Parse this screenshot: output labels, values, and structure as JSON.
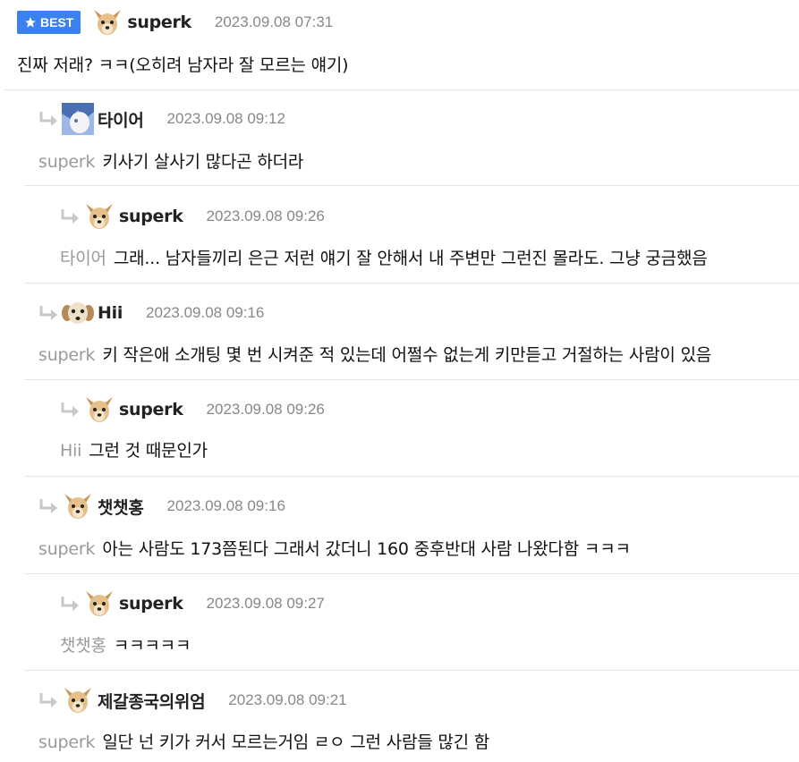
{
  "best_label": "BEST",
  "comments": [
    {
      "nick": "superk",
      "date": "2023.09.08 07:31",
      "mention": "",
      "text": "진짜 저래? ㅋㅋ(오히려 남자라 잘 모르는 얘기)"
    },
    {
      "nick": "타이어",
      "date": "2023.09.08 09:12",
      "mention": "superk",
      "text": "키사기 살사기 많다곤 하더라"
    },
    {
      "nick": "superk",
      "date": "2023.09.08 09:26",
      "mention": "타이어",
      "text": "그래... 남자들끼리 은근 저런 얘기 잘 안해서 내 주변만 그런진 몰라도. 그냥 궁금했음"
    },
    {
      "nick": "Hii",
      "date": "2023.09.08 09:16",
      "mention": "superk",
      "text": "키 작은애 소개팅 몇 번 시켜준 적 있는데 어쩔수 없는게 키만듣고 거절하는 사람이 있음"
    },
    {
      "nick": "superk",
      "date": "2023.09.08 09:26",
      "mention": "Hii",
      "text": "그런 것 때문인가"
    },
    {
      "nick": "챗챗홍",
      "date": "2023.09.08 09:16",
      "mention": "superk",
      "text": "아는 사람도 173쯤된다 그래서 갔더니 160 중후반대 사람 나왔다함 ㅋㅋㅋ"
    },
    {
      "nick": "superk",
      "date": "2023.09.08 09:27",
      "mention": "챗챗홍",
      "text": "ㅋㅋㅋㅋㅋ"
    },
    {
      "nick": "제갈종국의위엄",
      "date": "2023.09.08 09:21",
      "mention": "superk",
      "text": "일단 넌 키가 커서 모르는거임 ㄹㅇ 그런 사람들 많긴 함"
    }
  ],
  "icons": {
    "reply": "reply-arrow-icon",
    "best": "star-icon"
  },
  "colors": {
    "best_badge": "#3b82f0",
    "mention": "#9a9a9a",
    "date": "#888888"
  }
}
